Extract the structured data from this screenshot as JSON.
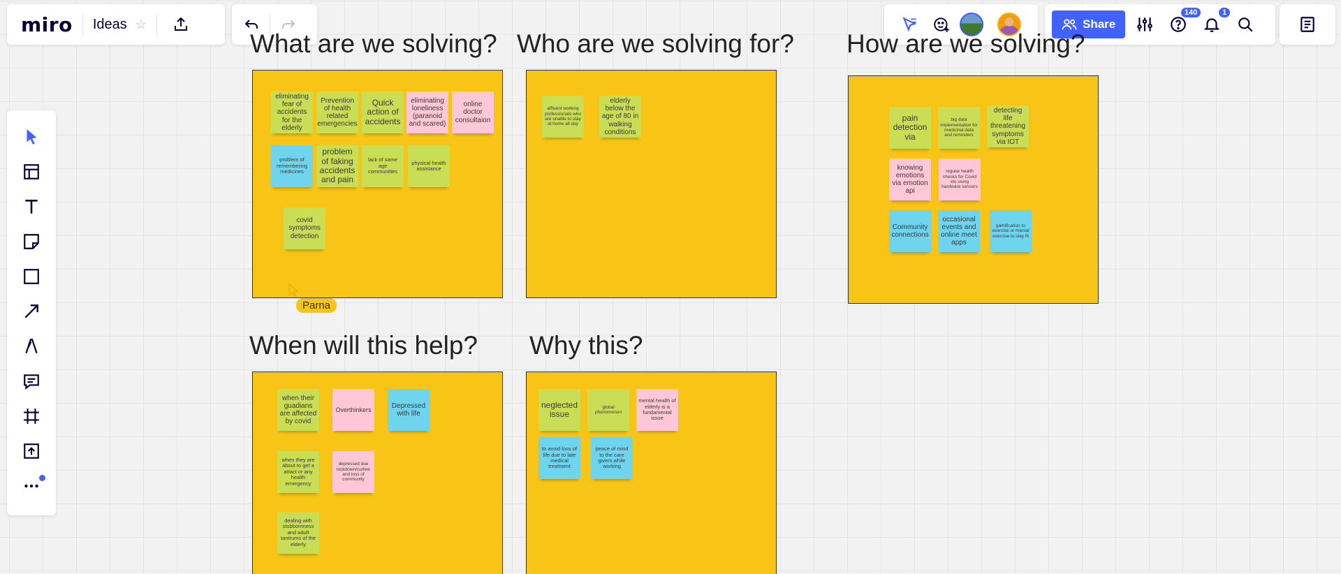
{
  "app": {
    "logo": "miro",
    "board_title": "Ideas"
  },
  "toolbar_right": {
    "share_label": "Share",
    "help_badge": "140",
    "notifications_badge": "1"
  },
  "cursor": {
    "user": "Parna"
  },
  "frames": [
    {
      "title": "What are we solving?",
      "notes": [
        {
          "text": "eliminating fear of accidents for the elderly",
          "color": "green"
        },
        {
          "text": "Prevention of health related emergencies",
          "color": "green"
        },
        {
          "text": "Quick action of accidents",
          "color": "green"
        },
        {
          "text": "eliminating loneliness (paranoid and scared)",
          "color": "pink"
        },
        {
          "text": "online doctor consultaion",
          "color": "pink"
        },
        {
          "text": "problem of remembering medicines",
          "color": "blue"
        },
        {
          "text": "problem of faking accidents and pain",
          "color": "green"
        },
        {
          "text": "lack of same age communities",
          "color": "green"
        },
        {
          "text": "physical health assistance",
          "color": "green"
        },
        {
          "text": "covid symptoms detection",
          "color": "green"
        }
      ]
    },
    {
      "title": "Who are we solving for?",
      "notes": [
        {
          "text": "affluent working professionals who are unable to stay at home all day",
          "color": "green"
        },
        {
          "text": "elderly below the age of 80 in walking conditions",
          "color": "green"
        }
      ]
    },
    {
      "title": "How are we solving?",
      "notes": [
        {
          "text": "pain detection via",
          "color": "green"
        },
        {
          "text": "big data implementation for medicinal data and reminders",
          "color": "green"
        },
        {
          "text": "detecting life threatening symptoms via IOT",
          "color": "green"
        },
        {
          "text": "knowing emotions via emotion api",
          "color": "pink"
        },
        {
          "text": "regular health checks for Covid etc using hardware sensors",
          "color": "pink"
        },
        {
          "text": "Community connections",
          "color": "blue"
        },
        {
          "text": "occasional events and online meet apps",
          "color": "blue"
        },
        {
          "text": "gamification to exercise or mental exercise to stay fit",
          "color": "blue"
        }
      ]
    },
    {
      "title": "When will this help?",
      "notes": [
        {
          "text": "when their guadians are affected by covid",
          "color": "green"
        },
        {
          "text": "Overthinkers",
          "color": "pink"
        },
        {
          "text": "Depressed with life",
          "color": "blue"
        },
        {
          "text": "when they are about to get a attact or any health emergency",
          "color": "green"
        },
        {
          "text": "depressed due lockdown/curfew and loss of community",
          "color": "pink"
        },
        {
          "text": "dealing with stubbornness and adult tantrums of the elderly",
          "color": "green"
        }
      ]
    },
    {
      "title": "Why this?",
      "notes": [
        {
          "text": "neglected issue",
          "color": "green"
        },
        {
          "text": "global phenomenon",
          "color": "green"
        },
        {
          "text": "mental health of elderly is a fundamental issue",
          "color": "pink"
        },
        {
          "text": "to avoid loss of life due to late medical treatment",
          "color": "blue"
        },
        {
          "text": "peace of mind to the care givers while working",
          "color": "blue"
        }
      ]
    }
  ],
  "colors": {
    "frame": "#f8c516",
    "green_note": "#c9de55",
    "pink_note": "#ffc7d8",
    "blue_note": "#6fd5ef",
    "accent": "#4262ff"
  },
  "icons": [
    "star-icon",
    "upload-icon",
    "undo-icon",
    "redo-icon",
    "reactions-icon",
    "add-emoji-icon",
    "settings-sliders-icon",
    "help-icon",
    "bell-icon",
    "search-icon",
    "notes-icon",
    "select-tool-icon",
    "templates-icon",
    "text-tool-icon",
    "sticky-note-icon",
    "shape-tool-icon",
    "arrow-tool-icon",
    "pen-tool-icon",
    "comment-tool-icon",
    "frame-tool-icon",
    "upload-tool-icon",
    "more-tools-icon"
  ]
}
